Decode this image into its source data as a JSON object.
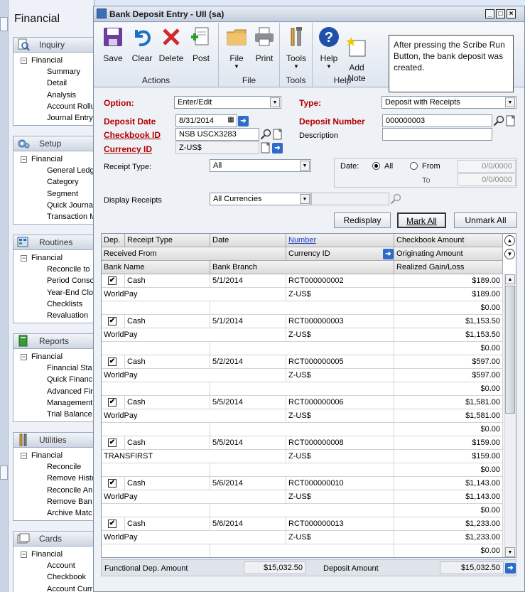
{
  "nav": {
    "title": "Financial",
    "sections": [
      {
        "heading": "Inquiry",
        "root": "Financial",
        "items": [
          "Summary",
          "Detail",
          "Analysis",
          "Account Rollu",
          "Journal Entry"
        ]
      },
      {
        "heading": "Setup",
        "root": "Financial",
        "items": [
          "General Ledg",
          "Category",
          "Segment",
          "Quick Journa",
          "Transaction M"
        ]
      },
      {
        "heading": "Routines",
        "root": "Financial",
        "items": [
          "Reconcile to",
          "Period Conso",
          "Year-End Clo",
          "Checklists",
          "Revaluation"
        ]
      },
      {
        "heading": "Reports",
        "root": "Financial",
        "items": [
          "Financial Sta",
          "Quick Financ",
          "Advanced Fir",
          "Management",
          "Trial Balance"
        ]
      },
      {
        "heading": "Utilities",
        "root": "Financial",
        "items": [
          "Reconcile",
          "Remove Histo",
          "Reconcile An",
          "Remove Ban",
          "Archive Matc"
        ]
      },
      {
        "heading": "Cards",
        "root": "Financial",
        "items": [
          "Account",
          "Checkbook",
          "Account Curr"
        ]
      }
    ]
  },
  "window": {
    "title": "Bank Deposit Entry  -  UII (sa)"
  },
  "toolbar": {
    "groups": [
      {
        "label": "Actions",
        "buttons": [
          "Save",
          "Clear",
          "Delete",
          "Post"
        ]
      },
      {
        "label": "File",
        "buttons": [
          "File",
          "Print"
        ]
      },
      {
        "label": "Tools",
        "buttons": [
          "Tools"
        ]
      },
      {
        "label": "Help",
        "buttons": [
          "Help",
          "Add\nNote"
        ]
      }
    ]
  },
  "note": "After pressing the Scribe Run Button, the bank deposit was created.",
  "form": {
    "option_label": "Option:",
    "option_value": "Enter/Edit",
    "type_label": "Type:",
    "type_value": "Deposit with Receipts",
    "deposit_date_label": "Deposit Date",
    "deposit_date_value": "8/31/2014",
    "deposit_number_label": "Deposit Number",
    "deposit_number_value": "000000003",
    "checkbook_label": "Checkbook ID",
    "checkbook_value": "NSB USCX3283",
    "description_label": "Description",
    "description_value": "",
    "currency_label": "Currency ID",
    "currency_value": "Z-US$",
    "receipt_type_label": "Receipt Type:",
    "receipt_type_value": "All",
    "date_label": "Date:",
    "radio_all": "All",
    "radio_from": "From",
    "to_label": "To",
    "from_date": "0/0/0000",
    "to_date": "0/0/0000",
    "display_receipts_label": "Display Receipts",
    "display_receipts_value": "All Currencies",
    "redisplay": "Redisplay",
    "mark_all": "Mark All",
    "unmark_all": "Unmark All"
  },
  "grid": {
    "headers1": [
      "Dep.",
      "Receipt Type",
      "Date",
      "Number",
      "Checkbook Amount"
    ],
    "headers2": [
      "Received From",
      "Currency ID",
      "Originating Amount"
    ],
    "headers3": [
      "Bank Name",
      "Bank Branch",
      "Realized Gain/Loss"
    ],
    "rows": [
      {
        "type": "Cash",
        "date": "5/1/2014",
        "number": "RCT000000002",
        "amount": "$189.00",
        "from": "WorldPay",
        "currency": "Z-US$",
        "orig": "$189.00",
        "gain": "$0.00"
      },
      {
        "type": "Cash",
        "date": "5/1/2014",
        "number": "RCT000000003",
        "amount": "$1,153.50",
        "from": "WorldPay",
        "currency": "Z-US$",
        "orig": "$1,153.50",
        "gain": "$0.00"
      },
      {
        "type": "Cash",
        "date": "5/2/2014",
        "number": "RCT000000005",
        "amount": "$597.00",
        "from": "WorldPay",
        "currency": "Z-US$",
        "orig": "$597.00",
        "gain": "$0.00"
      },
      {
        "type": "Cash",
        "date": "5/5/2014",
        "number": "RCT000000006",
        "amount": "$1,581.00",
        "from": "WorldPay",
        "currency": "Z-US$",
        "orig": "$1,581.00",
        "gain": "$0.00"
      },
      {
        "type": "Cash",
        "date": "5/5/2014",
        "number": "RCT000000008",
        "amount": "$159.00",
        "from": "TRANSFIRST",
        "currency": "Z-US$",
        "orig": "$159.00",
        "gain": "$0.00"
      },
      {
        "type": "Cash",
        "date": "5/6/2014",
        "number": "RCT000000010",
        "amount": "$1,143.00",
        "from": "WorldPay",
        "currency": "Z-US$",
        "orig": "$1,143.00",
        "gain": "$0.00"
      },
      {
        "type": "Cash",
        "date": "5/6/2014",
        "number": "RCT000000013",
        "amount": "$1,233.00",
        "from": "WorldPay",
        "currency": "Z-US$",
        "orig": "$1,233.00",
        "gain": "$0.00"
      }
    ]
  },
  "footer": {
    "functional_label": "Functional Dep. Amount",
    "functional_value": "$15,032.50",
    "deposit_label": "Deposit Amount",
    "deposit_value": "$15,032.50"
  }
}
